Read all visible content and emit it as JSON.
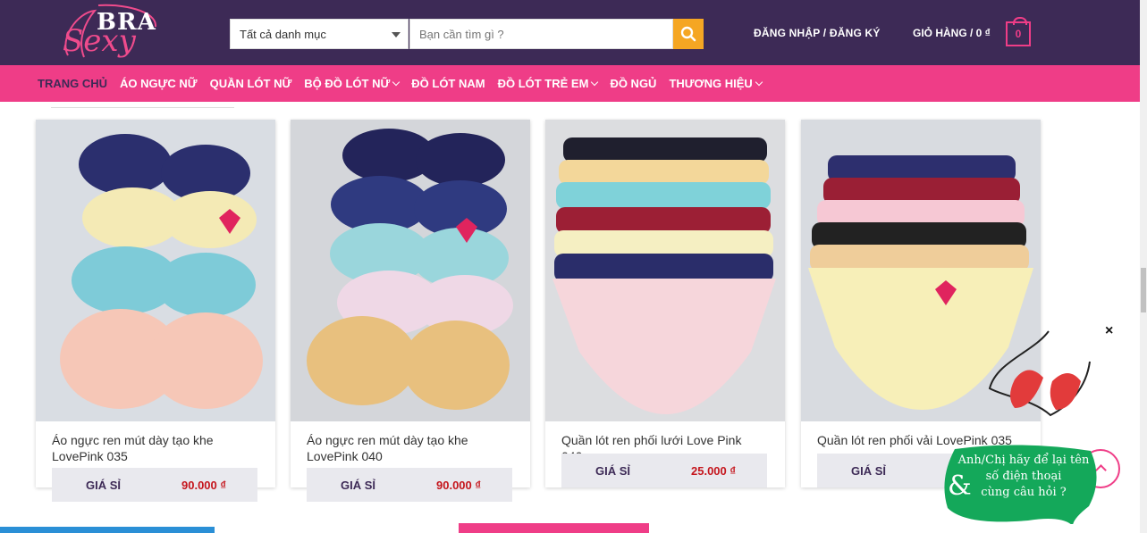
{
  "header": {
    "logo_word_top": "BRA",
    "logo_word_bottom": "Sexy",
    "category_select": "Tất cả danh mục",
    "search_placeholder": "Bạn cần tìm gì ?",
    "login_label": "ĐĂNG NHẬP / ĐĂNG KÝ",
    "cart_label": "GIỎ HÀNG / 0 ₫",
    "cart_count": "0"
  },
  "nav": {
    "items": [
      {
        "label": "TRANG CHỦ",
        "active": true,
        "dropdown": false
      },
      {
        "label": "ÁO NGỰC NỮ",
        "active": false,
        "dropdown": false
      },
      {
        "label": "QUẦN LÓT NỮ",
        "active": false,
        "dropdown": false
      },
      {
        "label": "BỘ ĐỒ LÓT NỮ",
        "active": false,
        "dropdown": true
      },
      {
        "label": "ĐỒ LÓT NAM",
        "active": false,
        "dropdown": false
      },
      {
        "label": "ĐỒ LÓT TRẺ EM",
        "active": false,
        "dropdown": true
      },
      {
        "label": "ĐỒ NGỦ",
        "active": false,
        "dropdown": false
      },
      {
        "label": "THƯƠNG HIỆU",
        "active": false,
        "dropdown": true
      }
    ]
  },
  "products": [
    {
      "title": "Áo ngực ren mút dày tạo khe LovePink 035",
      "price_label": "GIÁ SỈ",
      "price": "90.000 ₫",
      "kind": "bra"
    },
    {
      "title": "Áo ngực ren mút dày tạo khe LovePink 040",
      "price_label": "GIÁ SỈ",
      "price": "90.000 ₫",
      "kind": "bra"
    },
    {
      "title": "Quần lót ren phối lưới Love Pink 040",
      "price_label": "GIÁ SỈ",
      "price": "25.000 ₫",
      "kind": "panty"
    },
    {
      "title": "Quần lót ren phối vải LovePink 035",
      "price_label": "GIÁ SỈ",
      "price": "",
      "kind": "panty"
    }
  ],
  "popup": {
    "close_label": "×",
    "ampersand": "&",
    "message_line1": "Anh/Chị hãy để lại tên",
    "message_line2": "số điện thoại",
    "message_line3": "cùng câu hỏi ?"
  },
  "colors": {
    "header_bg": "#3d2a56",
    "nav_bg": "#ef3d87",
    "search_button": "#f5a623",
    "price_text": "#c5161d",
    "bubble_bg": "#14a85a"
  },
  "icons": {
    "search": "search-icon",
    "cart": "cart-icon",
    "close": "close-icon",
    "scroll_top": "chevron-up-icon"
  }
}
